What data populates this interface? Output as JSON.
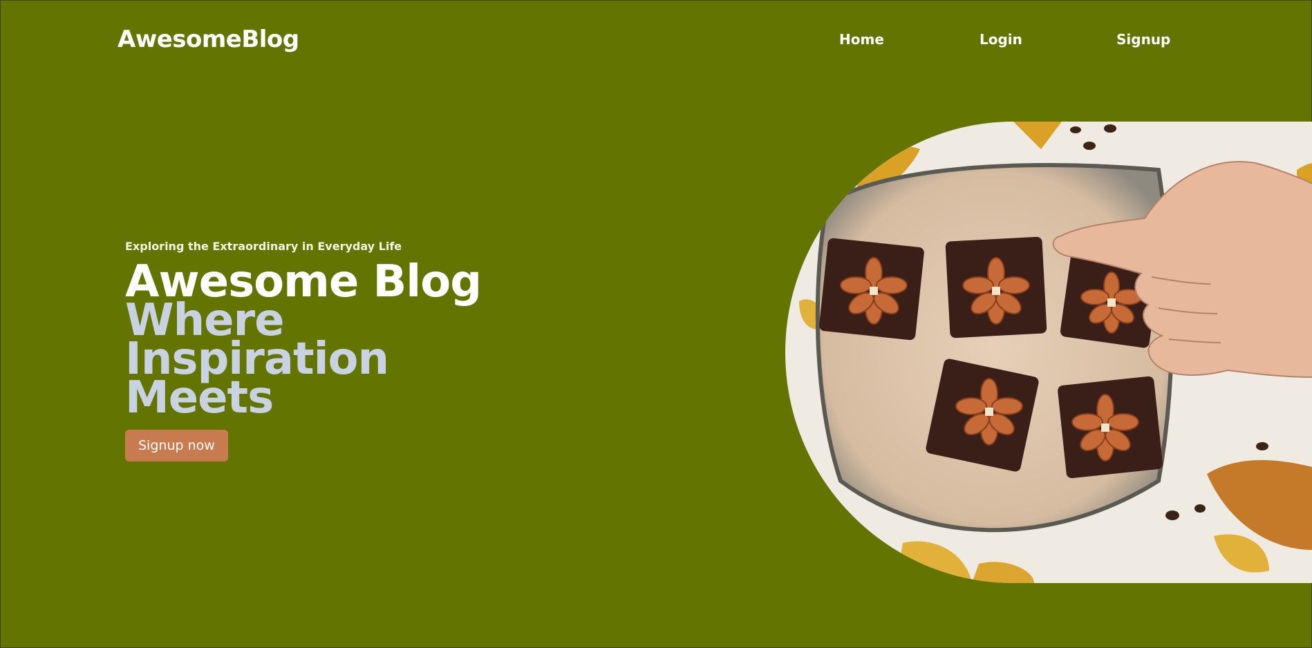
{
  "header": {
    "brand": "AwesomeBlog",
    "nav": [
      {
        "label": "Home"
      },
      {
        "label": "Login"
      },
      {
        "label": "Signup"
      }
    ]
  },
  "hero": {
    "tagline": "Exploring the Extraordinary in Everyday Life",
    "headline": "Awesome Blog",
    "subheadline_lines": [
      "Where",
      "Inspiration",
      "Meets"
    ],
    "cta_label": "Signup now"
  },
  "colors": {
    "background": "#637401",
    "accent_button": "#c87b4f",
    "subheadline": "#c8d2e0"
  }
}
